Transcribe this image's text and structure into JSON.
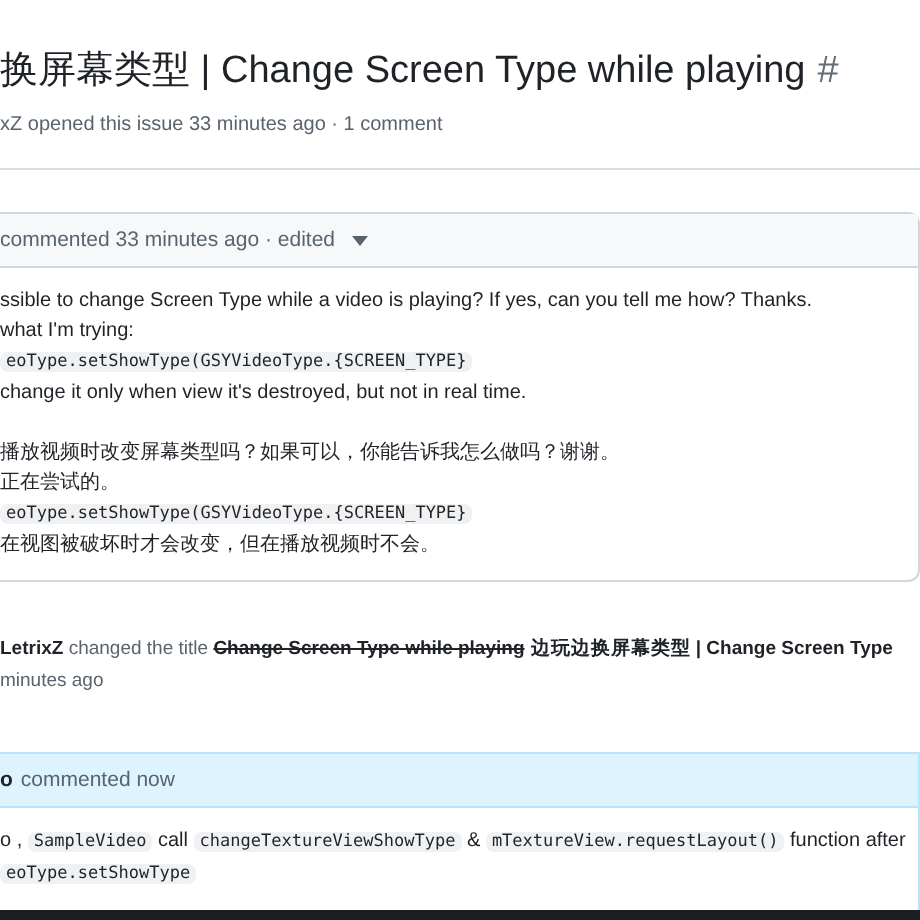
{
  "issue": {
    "title": "换屏幕类型 | Change Screen Type while playing",
    "number": "#",
    "meta": "xZ opened this issue 33 minutes ago · 1 comment"
  },
  "comments": [
    {
      "action": "commented 33 minutes ago · edited",
      "highlighted": false,
      "paragraphs": [
        [
          [
            {
              "kind": "text",
              "text": "ssible to change Screen Type while a video is playing? If yes, can you tell me how? Thanks."
            }
          ],
          [
            {
              "kind": "text",
              "text": "what I'm trying:"
            }
          ],
          [
            {
              "kind": "code",
              "text": "eoType.setShowType(GSYVideoType.{SCREEN_TYPE}"
            }
          ],
          [
            {
              "kind": "text",
              "text": "change it only when view it's destroyed, but not in real time."
            }
          ]
        ],
        [
          [
            {
              "kind": "text",
              "text": "播放视频时改变屏幕类型吗？如果可以，你能告诉我怎么做吗？谢谢。"
            }
          ],
          [
            {
              "kind": "text",
              "text": "正在尝试的。"
            }
          ],
          [
            {
              "kind": "code",
              "text": "eoType.setShowType(GSYVideoType.{SCREEN_TYPE}"
            }
          ],
          [
            {
              "kind": "text",
              "text": "在视图被破坏时才会改变，但在播放视频时不会。"
            }
          ]
        ]
      ]
    }
  ],
  "event": {
    "segments": [
      {
        "kind": "bold",
        "text": "LetrixZ"
      },
      {
        "kind": "text",
        "text": " changed the title "
      },
      {
        "kind": "strike",
        "text": "Change Screen Type while playing"
      },
      {
        "kind": "bold",
        "text": "边玩边换屏幕类型 | Change Screen Type"
      }
    ],
    "time": "minutes ago"
  },
  "reply": {
    "author": "o",
    "action": "commented now",
    "highlighted": true,
    "paragraphs": [
      [
        [
          {
            "kind": "text",
            "text": "o , "
          },
          {
            "kind": "code",
            "text": "SampleVideo"
          },
          {
            "kind": "text",
            "text": " call "
          },
          {
            "kind": "code",
            "text": "changeTextureViewShowType"
          },
          {
            "kind": "text",
            "text": " & "
          },
          {
            "kind": "code",
            "text": "mTextureView.requestLayout()"
          },
          {
            "kind": "text",
            "text": " function after"
          }
        ],
        [
          {
            "kind": "code",
            "text": "eoType.setShowType"
          }
        ]
      ]
    ]
  }
}
